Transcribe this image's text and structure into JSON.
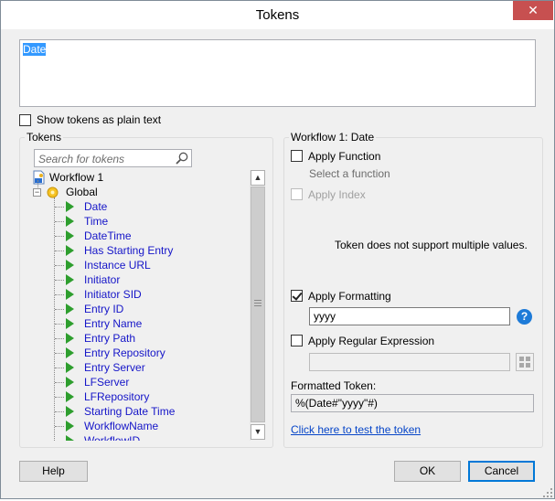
{
  "window": {
    "title": "Tokens",
    "close_glyph": "✕"
  },
  "token_text": "Date",
  "show_plain_text": {
    "label": "Show tokens as plain text",
    "checked": false
  },
  "tokens_panel": {
    "title": "Tokens",
    "search_placeholder": "Search for tokens",
    "workflow_label": "Workflow 1",
    "global_label": "Global",
    "items": [
      "Date",
      "Time",
      "DateTime",
      "Has Starting Entry",
      "Instance URL",
      "Initiator",
      "Initiator SID",
      "Entry ID",
      "Entry Name",
      "Entry Path",
      "Entry Repository",
      "Entry Server",
      "LFServer",
      "LFRepository",
      "Starting Date Time",
      "WorkflowName",
      "WorkflowID"
    ]
  },
  "right_panel": {
    "title": "Workflow 1: Date",
    "apply_function": {
      "label": "Apply Function",
      "checked": false
    },
    "select_function": "Select a function",
    "apply_index": {
      "label": "Apply Index",
      "checked": false
    },
    "multi_value_msg": "Token does not support multiple values.",
    "apply_formatting": {
      "label": "Apply Formatting",
      "checked": true,
      "value": "yyyy"
    },
    "help_glyph": "?",
    "apply_regex": {
      "label": "Apply Regular Expression",
      "checked": false,
      "value": ""
    },
    "formatted_token_label": "Formatted Token:",
    "formatted_token_value": "%(Date#\"yyyy\"#)",
    "test_link": "Click here to test the token"
  },
  "buttons": {
    "help": "Help",
    "ok": "OK",
    "cancel": "Cancel"
  },
  "colors": {
    "accent": "#0078d7",
    "close": "#c75050",
    "token_text": "#1515c8",
    "token_icon": "#2e9e2e"
  }
}
